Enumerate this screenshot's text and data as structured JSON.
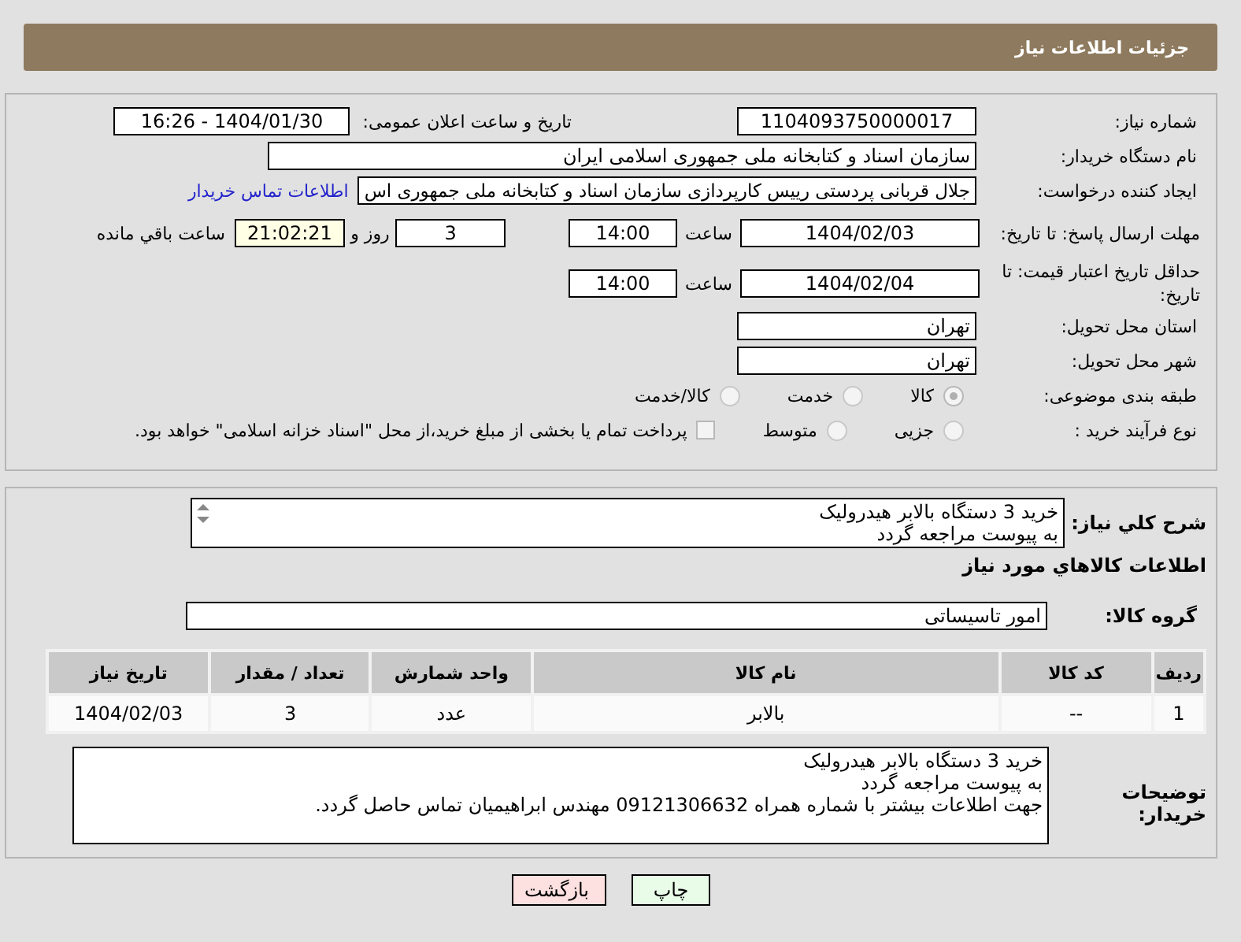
{
  "header": {
    "title": "جزئیات اطلاعات نیاز"
  },
  "need_number": {
    "label": "شماره نیاز:",
    "value": "1104093750000017"
  },
  "announce": {
    "label": "تاریخ و ساعت اعلان عمومی:",
    "value": "1404/01/30 - 16:26"
  },
  "buyer_org": {
    "label": "نام دستگاه خریدار:",
    "value": "سازمان اسناد و کتابخانه ملی جمهوری اسلامی ایران"
  },
  "requester": {
    "label": "ایجاد کننده درخواست:",
    "value": "جلال قربانی پردستی رییس کارپردازی سازمان اسناد و کتابخانه ملی جمهوری اس",
    "link": "اطلاعات تماس خریدار"
  },
  "deadline": {
    "label": "مهلت ارسال پاسخ: تا تاریخ:",
    "date": "1404/02/03",
    "time_label": "ساعت",
    "time": "14:00",
    "days": "3",
    "days_label": "روز و",
    "remaining": "21:02:21",
    "remaining_label": "ساعت باقي مانده"
  },
  "validity": {
    "label": "حداقل تاریخ اعتبار قیمت: تا تاریخ:",
    "date": "1404/02/04",
    "time_label": "ساعت",
    "time": "14:00"
  },
  "province": {
    "label": "استان محل تحویل:",
    "value": "تهران"
  },
  "city": {
    "label": "شهر محل تحویل:",
    "value": "تهران"
  },
  "category": {
    "label": "طبقه بندی موضوعی:",
    "options": [
      {
        "label": "کالا",
        "selected": true
      },
      {
        "label": "خدمت",
        "selected": false
      },
      {
        "label": "کالا/خدمت",
        "selected": false
      }
    ]
  },
  "process": {
    "label": "نوع فرآیند خرید :",
    "options": [
      {
        "label": "جزیی",
        "selected": false
      },
      {
        "label": "متوسط",
        "selected": false
      }
    ],
    "treasury": {
      "label": "پرداخت تمام یا بخشی از مبلغ خرید،از محل \"اسناد خزانه اسلامی\" خواهد بود.",
      "checked": false
    }
  },
  "description": {
    "label": "شرح کلي نیاز:",
    "lines": [
      "خرید 3 دستگاه بالابر هیدرولیک",
      "به پیوست مراجعه گردد"
    ]
  },
  "goods_title": "اطلاعات کالاهاي مورد نیاز",
  "goods_group": {
    "label": "گروه کالا:",
    "value": "امور تاسیساتی"
  },
  "table": {
    "columns": [
      "ردیف",
      "کد کالا",
      "نام کالا",
      "واحد شمارش",
      "تعداد / مقدار",
      "تاریخ نیاز"
    ],
    "rows": [
      [
        "1",
        "--",
        "بالابر",
        "عدد",
        "3",
        "1404/02/03"
      ]
    ]
  },
  "buyer_notes": {
    "label": "توضیحات خریدار:",
    "lines": [
      "خرید 3 دستگاه بالابر هیدرولیک",
      "به پیوست مراجعه گردد",
      "جهت اطلاعات بیشتر با شماره همراه 09121306632 مهندس ابراهیمیان تماس حاصل گردد."
    ]
  },
  "buttons": [
    {
      "label": "چاپ",
      "kind": "print"
    },
    {
      "label": "بازگشت",
      "kind": "back"
    }
  ]
}
